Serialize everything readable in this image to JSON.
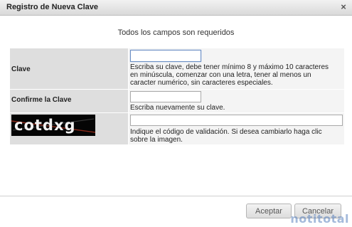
{
  "dialog": {
    "title": "Registro de Nueva Clave",
    "close_icon": "×"
  },
  "notice": "Todos los campos son requeridos",
  "form": {
    "password": {
      "label": "Clave",
      "value": "",
      "help_lines": [
        "Escriba su clave, debe tener mínimo 8 y máximo 10 caracteres",
        "en minúscula, comenzar con una letra, tener al menos un",
        "caracter numérico, sin caracteres especiales."
      ]
    },
    "confirm": {
      "label": "Confirme la Clave",
      "value": "",
      "help": "Escriba nuevamente su clave."
    },
    "captcha": {
      "image_text": "cotdxg",
      "value": "",
      "help_lines": [
        "Indique el código de validación. Si desea cambiarlo haga clic",
        "sobre la imagen."
      ]
    }
  },
  "buttons": {
    "accept": "Aceptar",
    "cancel": "Cancelar"
  },
  "watermark": "notitotal"
}
